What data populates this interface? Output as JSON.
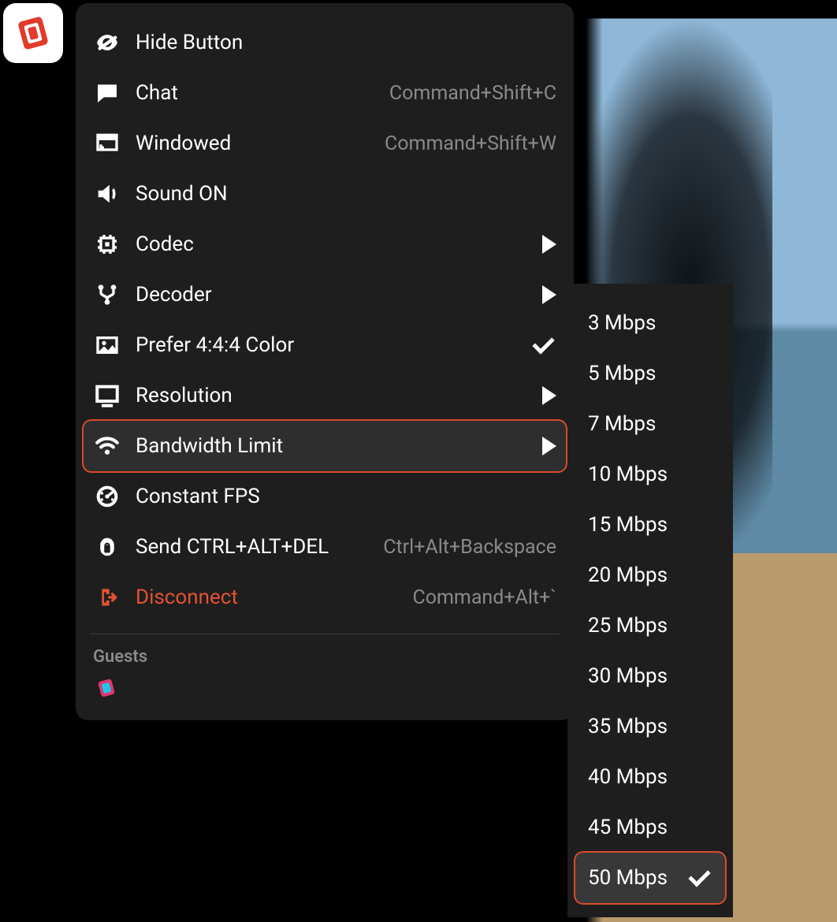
{
  "menu": {
    "items": [
      {
        "icon": "eye-off-icon",
        "label": "Hide Button",
        "type": "plain"
      },
      {
        "icon": "chat-icon",
        "label": "Chat",
        "type": "shortcut",
        "shortcut": "Command+Shift+C"
      },
      {
        "icon": "window-icon",
        "label": "Windowed",
        "type": "shortcut",
        "shortcut": "Command+Shift+W"
      },
      {
        "icon": "speaker-icon",
        "label": "Sound ON",
        "type": "plain"
      },
      {
        "icon": "chip-icon",
        "label": "Codec",
        "type": "submenu"
      },
      {
        "icon": "fork-icon",
        "label": "Decoder",
        "type": "submenu"
      },
      {
        "icon": "image-icon",
        "label": "Prefer 4:4:4 Color",
        "type": "check"
      },
      {
        "icon": "monitor-icon",
        "label": "Resolution",
        "type": "submenu"
      },
      {
        "icon": "wifi-icon",
        "label": "Bandwidth Limit",
        "type": "submenu",
        "highlighted": true
      },
      {
        "icon": "gauge-icon",
        "label": "Constant FPS",
        "type": "plain"
      },
      {
        "icon": "lock-icon",
        "label": "Send CTRL+ALT+DEL",
        "type": "shortcut",
        "shortcut": "Ctrl+Alt+Backspace"
      },
      {
        "icon": "disconnect-icon",
        "label": "Disconnect",
        "type": "shortcut",
        "shortcut": "Command+Alt+`",
        "danger": true
      }
    ],
    "guests_label": "Guests"
  },
  "bandwidth_submenu": {
    "options": [
      {
        "label": "3 Mbps"
      },
      {
        "label": "5 Mbps"
      },
      {
        "label": "7 Mbps"
      },
      {
        "label": "10 Mbps"
      },
      {
        "label": "15 Mbps"
      },
      {
        "label": "20 Mbps"
      },
      {
        "label": "25 Mbps"
      },
      {
        "label": "30 Mbps"
      },
      {
        "label": "35 Mbps"
      },
      {
        "label": "40 Mbps"
      },
      {
        "label": "45 Mbps"
      },
      {
        "label": "50 Mbps",
        "selected": true
      }
    ]
  }
}
